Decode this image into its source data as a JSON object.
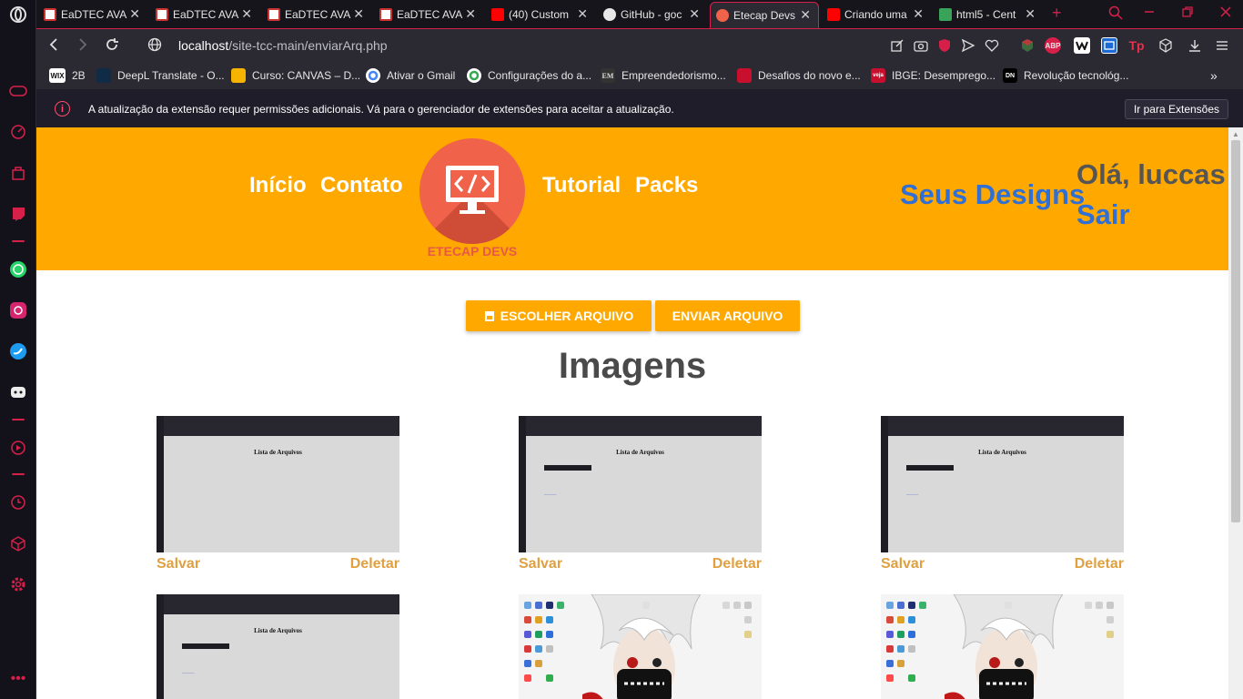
{
  "browser": {
    "tabs": [
      {
        "title": "EaDTEC AVA",
        "favicon": "eadtec-icon"
      },
      {
        "title": "EaDTEC AVA",
        "favicon": "eadtec-icon"
      },
      {
        "title": "EaDTEC AVA",
        "favicon": "eadtec-icon"
      },
      {
        "title": "EaDTEC AVA",
        "favicon": "eadtec-icon"
      },
      {
        "title": "(40) Custom",
        "favicon": "youtube-icon"
      },
      {
        "title": "GitHub - goc",
        "favicon": "github-icon"
      },
      {
        "title": "Etecap Devs",
        "favicon": "etecap-icon",
        "active": true
      },
      {
        "title": "Criando uma",
        "favicon": "youtube-icon"
      },
      {
        "title": "html5 - Cent",
        "favicon": "stackoverflow-icon"
      }
    ],
    "url_host": "localhost",
    "url_path": "/site-tcc-main/enviarArq.php",
    "bookmarks": [
      {
        "label": "2B",
        "icon": "WIX"
      },
      {
        "label": "DeepL Translate - O...",
        "icon": "D"
      },
      {
        "label": "Curso: CANVAS – D...",
        "icon": "M"
      },
      {
        "label": "Ativar o Gmail",
        "icon": "G"
      },
      {
        "label": "Configurações do a...",
        "icon": "G"
      },
      {
        "label": "Empreendedorismo...",
        "icon": "EM"
      },
      {
        "label": "Desafios do novo e...",
        "icon": "D"
      },
      {
        "label": "IBGE: Desemprego...",
        "icon": "veja"
      },
      {
        "label": "Revolução tecnológ...",
        "icon": "DN"
      }
    ],
    "infobar_text": "A atualização da extensão requer permissões adicionais. Vá para o gerenciador de extensões para aceitar a atualização.",
    "infobar_button": "Ir para Extensões",
    "ext_abp": "ABP",
    "ext_tp": "Tp"
  },
  "site": {
    "nav": {
      "inicio": "Início",
      "contato": "Contato",
      "tutorial": "Tutorial",
      "packs": "Packs"
    },
    "logo_text": "ETECAP DEVS",
    "seus_designs": "Seus Designs",
    "greeting": "Olá, luccas",
    "logout": "Sair",
    "choose_file": "ESCOLHER ARQUIVO",
    "send_file": "ENVIAR ARQUIVO",
    "section_title": "Imagens",
    "thumb_caption": "Lista de Arquivos",
    "cards": [
      {
        "save": "Salvar",
        "delete": "Deletar",
        "kind": "screenshot-empty"
      },
      {
        "save": "Salvar",
        "delete": "Deletar",
        "kind": "screenshot-table"
      },
      {
        "save": "Salvar",
        "delete": "Deletar",
        "kind": "screenshot-table"
      },
      {
        "kind": "screenshot-table"
      },
      {
        "kind": "wallpaper"
      },
      {
        "kind": "wallpaper"
      }
    ]
  },
  "colors": {
    "accent": "#ffa800",
    "opera_red": "#d6204a",
    "link_blue": "#2f6fd6",
    "card_link": "#e0a040"
  }
}
